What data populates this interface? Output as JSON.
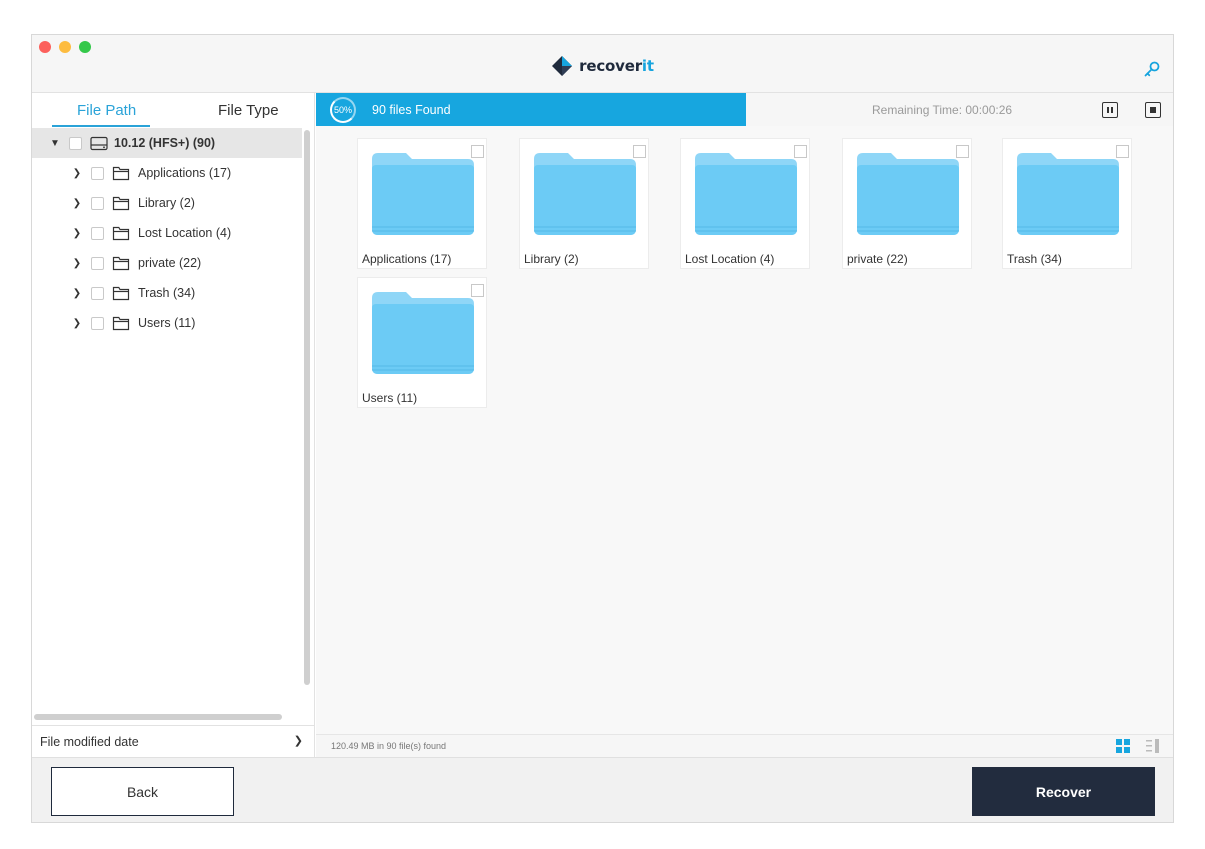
{
  "app": {
    "brand_prefix": "recover",
    "brand_suffix": "it"
  },
  "sidebar": {
    "tabs": [
      {
        "label": "File Path",
        "active": true
      },
      {
        "label": "File Type",
        "active": false
      }
    ],
    "tree": {
      "root": {
        "label": "10.12 (HFS+) (90)",
        "expanded": true
      },
      "children": [
        {
          "label": "Applications (17)"
        },
        {
          "label": "Library (2)"
        },
        {
          "label": "Lost Location (4)"
        },
        {
          "label": "private (22)"
        },
        {
          "label": "Trash (34)"
        },
        {
          "label": "Users (11)"
        }
      ]
    },
    "filter_label": "File modified date"
  },
  "status": {
    "progress_percent": "50%",
    "progress_fraction": 0.5,
    "found_text": "90 files Found",
    "remaining_text": "Remaining Time: 00:00:26"
  },
  "grid": {
    "items": [
      {
        "label": "Applications (17)"
      },
      {
        "label": "Library (2)"
      },
      {
        "label": "Lost Location (4)"
      },
      {
        "label": "private (22)"
      },
      {
        "label": "Trash (34)"
      },
      {
        "label": "Users (11)"
      }
    ]
  },
  "footer": {
    "info": "120.49 MB in 90 file(s) found"
  },
  "buttons": {
    "back": "Back",
    "recover": "Recover"
  },
  "colors": {
    "accent": "#17a6df",
    "primary_button": "#222c3e",
    "folder": "#6ccbf5"
  }
}
